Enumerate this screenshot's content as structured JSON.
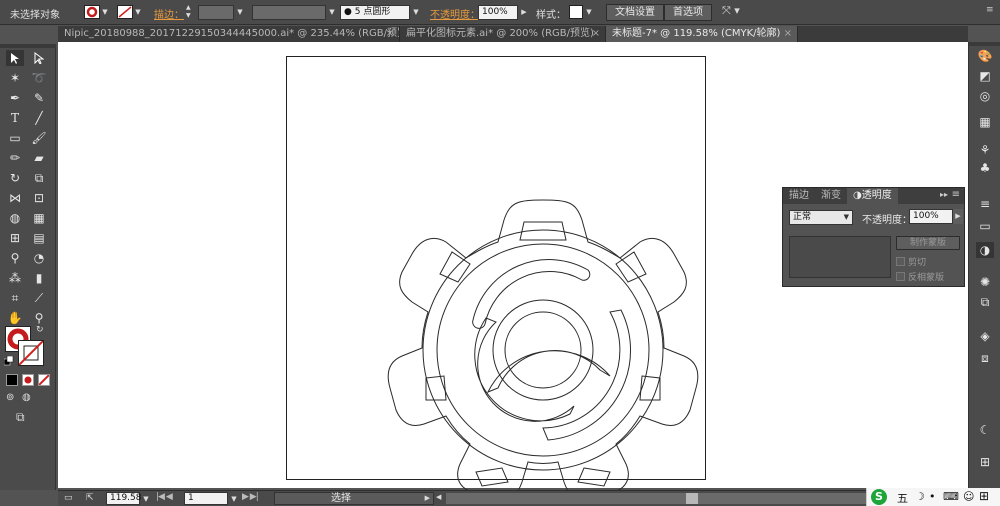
{
  "control_bar": {
    "selection_state": "未选择对象",
    "stroke_label": "描边：",
    "brush_label": "5 点圆形",
    "opacity_label": "不透明度：",
    "opacity_value": "100%",
    "style_label": "样式：",
    "doc_settings_button": "文档设置",
    "preferences_button": "首选项"
  },
  "tabs": [
    {
      "label": "Nipic_20180988_20171229150344445000.ai* @ 235.44% (RGB/预览)",
      "active": false
    },
    {
      "label": "扁平化图标元素.ai* @ 200% (RGB/预览)",
      "active": false
    },
    {
      "label": "未标题-7* @ 119.58% (CMYK/轮廓)",
      "active": true
    }
  ],
  "transparency_panel": {
    "tabs": [
      "描边",
      "渐变",
      "透明度"
    ],
    "blend_mode": "正常",
    "opacity_label": "不透明度：",
    "opacity_value": "100%",
    "make_mask_button": "制作蒙版",
    "clip_label": "剪切",
    "invert_mask_label": "反相蒙版"
  },
  "status_bar": {
    "zoom": "119.58",
    "page": "1",
    "tool_name": "选择"
  },
  "taskbar": {
    "ime_label": "五"
  },
  "colors": {
    "accent_orange": "#e89a3c",
    "panel_bg": "#535353",
    "canvas_bg": "#ffffff"
  }
}
